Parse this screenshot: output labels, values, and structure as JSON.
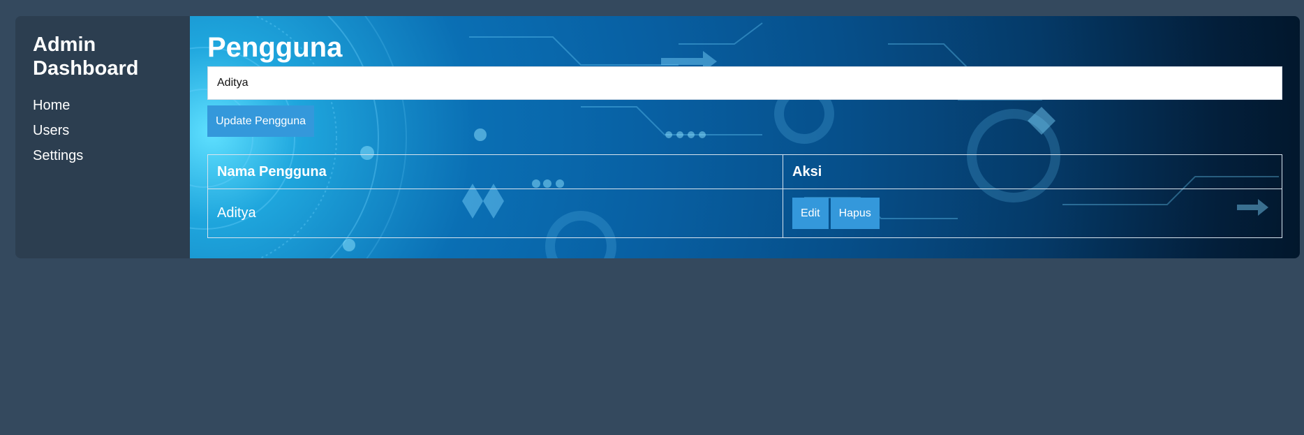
{
  "sidebar": {
    "title": "Admin Dashboard",
    "items": [
      {
        "label": "Home"
      },
      {
        "label": "Users"
      },
      {
        "label": "Settings"
      }
    ]
  },
  "main": {
    "title": "Pengguna",
    "name_input_value": "Aditya",
    "update_button_label": "Update Pengguna",
    "table": {
      "headers": [
        "Nama Pengguna",
        "Aksi"
      ],
      "rows": [
        {
          "name": "Aditya",
          "actions": [
            "Edit",
            "Hapus"
          ]
        }
      ]
    }
  },
  "colors": {
    "page_background": "#34495e",
    "sidebar_background": "#2c3e50",
    "button_accent": "#3498db"
  }
}
